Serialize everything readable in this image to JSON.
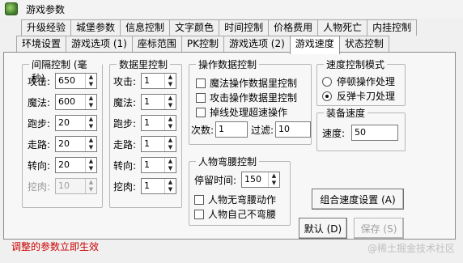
{
  "window": {
    "title": "游戏参数"
  },
  "tabs_row1": [
    "升级经验",
    "城堡参数",
    "信息控制",
    "文字颜色",
    "时间控制",
    "价格费用",
    "人物死亡",
    "内挂控制"
  ],
  "tabs_row2": [
    "环境设置",
    "游戏选项 (1)",
    "座标范围",
    "PK控制",
    "游戏选项 (2)",
    "游戏速度",
    "状态控制"
  ],
  "active_tab": "游戏速度",
  "interval": {
    "title": "间隔控制 (毫秒)",
    "rows": [
      {
        "label": "攻击:",
        "value": "650",
        "disabled": false
      },
      {
        "label": "魔法:",
        "value": "600",
        "disabled": false
      },
      {
        "label": "跑步:",
        "value": "20",
        "disabled": false
      },
      {
        "label": "走路:",
        "value": "20",
        "disabled": false
      },
      {
        "label": "转向:",
        "value": "20",
        "disabled": false
      },
      {
        "label": "挖肉:",
        "value": "10",
        "disabled": true
      }
    ]
  },
  "quantity": {
    "title": "数据里控制",
    "rows": [
      {
        "label": "攻击:",
        "value": "1"
      },
      {
        "label": "魔法:",
        "value": "1"
      },
      {
        "label": "跑步:",
        "value": "1"
      },
      {
        "label": "走路:",
        "value": "1"
      },
      {
        "label": "转向:",
        "value": "1"
      },
      {
        "label": "挖肉:",
        "value": "1"
      }
    ]
  },
  "operation": {
    "title": "操作数据控制",
    "checks": [
      "魔法操作数据里控制",
      "攻击操作数据里控制",
      "掉线处理超速操作"
    ],
    "count_label": "次数:",
    "count_value": "1",
    "filter_label": "过滤:",
    "filter_value": "10"
  },
  "mode": {
    "title": "速度控制模式",
    "options": [
      "停顿操作处理",
      "反弹卡刀处理"
    ],
    "selected": 1
  },
  "equip": {
    "title": "装备速度",
    "label": "速度:",
    "value": "50"
  },
  "bow": {
    "title": "人物弯腰控制",
    "stay_label": "停留时间:",
    "stay_value": "150",
    "checks": [
      "人物无弯腰动作",
      "人物自己不弯腰"
    ]
  },
  "buttons": {
    "combo": "组合速度设置 (A)",
    "default": "默认 (D)",
    "save": "保存 (S)"
  },
  "status_text": "调整的参数立即生效",
  "watermark": "@稀土掘金技术社区"
}
